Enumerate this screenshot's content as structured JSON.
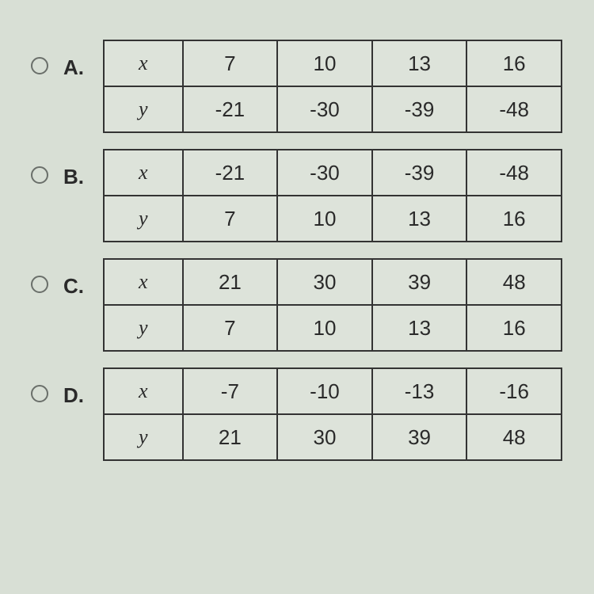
{
  "chart_data": [
    {
      "type": "table",
      "label": "A.",
      "rows": [
        {
          "var": "x",
          "values": [
            "7",
            "10",
            "13",
            "16"
          ]
        },
        {
          "var": "y",
          "values": [
            "-21",
            "-30",
            "-39",
            "-48"
          ]
        }
      ]
    },
    {
      "type": "table",
      "label": "B.",
      "rows": [
        {
          "var": "x",
          "values": [
            "-21",
            "-30",
            "-39",
            "-48"
          ]
        },
        {
          "var": "y",
          "values": [
            "7",
            "10",
            "13",
            "16"
          ]
        }
      ]
    },
    {
      "type": "table",
      "label": "C.",
      "rows": [
        {
          "var": "x",
          "values": [
            "21",
            "30",
            "39",
            "48"
          ]
        },
        {
          "var": "y",
          "values": [
            "7",
            "10",
            "13",
            "16"
          ]
        }
      ]
    },
    {
      "type": "table",
      "label": "D.",
      "rows": [
        {
          "var": "x",
          "values": [
            "-7",
            "-10",
            "-13",
            "-16"
          ]
        },
        {
          "var": "y",
          "values": [
            "21",
            "30",
            "39",
            "48"
          ]
        }
      ]
    }
  ]
}
